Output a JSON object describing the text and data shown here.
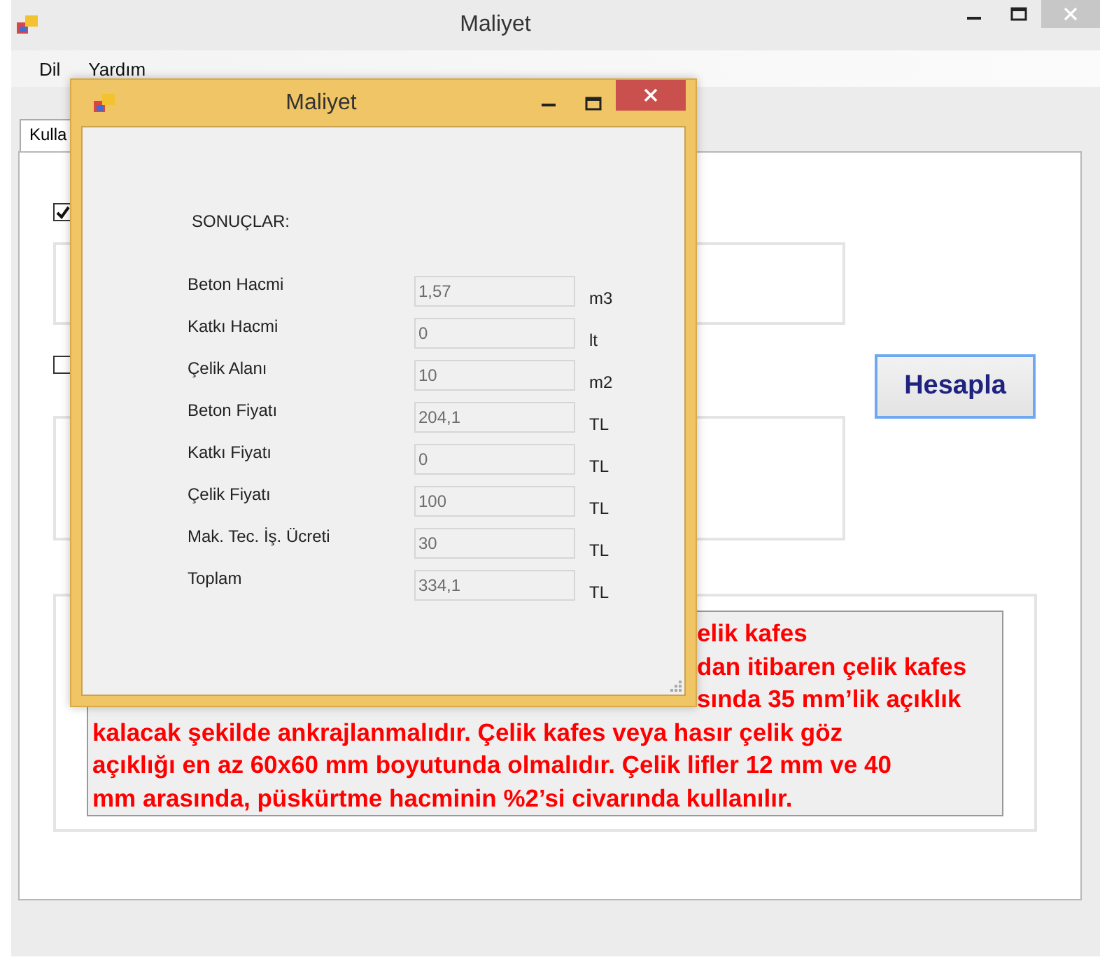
{
  "window": {
    "title": "Maliyet"
  },
  "menu": [
    {
      "label": "Dil"
    },
    {
      "label": "Yardım"
    }
  ],
  "tabs": [
    {
      "label": "Kulla",
      "selected": true
    }
  ],
  "options": [
    {
      "checked": true
    },
    {
      "checked": false
    }
  ],
  "calculate_button": "Hesapla",
  "note_lines": [
    {
      "kind": "partial",
      "text": "elik kafes"
    },
    {
      "kind": "partial",
      "text": "dan itibaren çelik kafes"
    },
    {
      "kind": "partial",
      "text": "sında 35 mm’lik açıklık"
    },
    {
      "kind": "full",
      "text": "kalacak şekilde ankrajlanmalıdır. Çelik kafes veya hasır çelik göz"
    },
    {
      "kind": "full",
      "text": "açıklığı en az 60x60 mm boyutunda olmalıdır.  Çelik lifler 12 mm ve 40"
    },
    {
      "kind": "full",
      "text": "mm arasında, püskürtme hacminin %2’si civarında kullanılır."
    }
  ],
  "dialog": {
    "title": "Maliyet",
    "heading": "SONUÇLAR:",
    "results": [
      {
        "label": "Beton Hacmi",
        "value": "1,57",
        "unit": "m3"
      },
      {
        "label": "Katkı Hacmi",
        "value": "0",
        "unit": "lt"
      },
      {
        "label": "Çelik Alanı",
        "value": "10",
        "unit": "m2"
      },
      {
        "label": "Beton Fiyatı",
        "value": "204,1",
        "unit": "TL"
      },
      {
        "label": "Katkı Fiyatı",
        "value": "0",
        "unit": "TL"
      },
      {
        "label": "Çelik Fiyatı",
        "value": "100",
        "unit": "TL"
      },
      {
        "label": "Mak. Tec. İş. Ücreti",
        "value": "30",
        "unit": "TL"
      },
      {
        "label": "Toplam",
        "value": "334,1",
        "unit": "TL"
      }
    ]
  }
}
